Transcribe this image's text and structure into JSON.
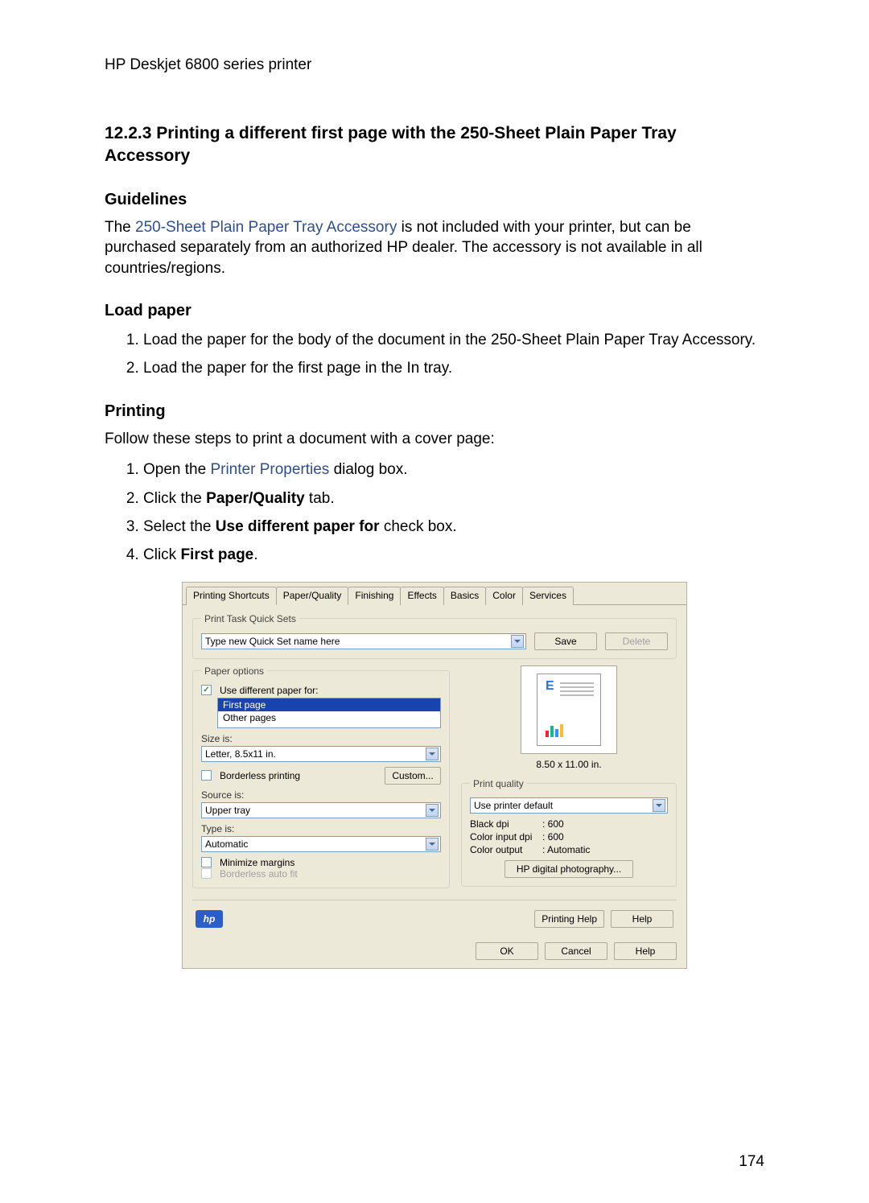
{
  "header": {
    "printer_name": "HP Deskjet 6800 series printer"
  },
  "section": {
    "number_title": "12.2.3  Printing a different first page with the 250-Sheet Plain Paper Tray Accessory"
  },
  "guidelines": {
    "heading": "Guidelines",
    "text_before_link": "The ",
    "link": "250-Sheet Plain Paper Tray Accessory",
    "text_after_link": " is not included with your printer, but can be purchased separately from an authorized HP dealer. The accessory is not available in all countries/regions."
  },
  "loadpaper": {
    "heading": "Load paper",
    "step1": "Load the paper for the body of the document in the 250-Sheet Plain Paper Tray Accessory.",
    "step2": "Load the paper for the first page in the In tray."
  },
  "printing": {
    "heading": "Printing",
    "intro": "Follow these steps to print a document with a cover page:",
    "step1_before": "Open the ",
    "step1_link": "Printer Properties",
    "step1_after": " dialog box.",
    "step2_before": "Click the ",
    "step2_bold": "Paper/Quality",
    "step2_after": " tab.",
    "step3_before": "Select the ",
    "step3_bold": "Use different paper for",
    "step3_after": " check box.",
    "step4_before": "Click ",
    "step4_bold": "First page",
    "step4_after": "."
  },
  "dialog": {
    "tabs": {
      "t1": "Printing Shortcuts",
      "t2": "Paper/Quality",
      "t3": "Finishing",
      "t4": "Effects",
      "t5": "Basics",
      "t6": "Color",
      "t7": "Services"
    },
    "quicksets": {
      "legend": "Print Task Quick Sets",
      "placeholder": "Type new Quick Set name here",
      "save": "Save",
      "delete": "Delete"
    },
    "paper_options": {
      "legend": "Paper options",
      "use_diff": "Use different paper for:",
      "first_page": "First page",
      "other_pages": "Other pages",
      "size_label": "Size is:",
      "size_value": "Letter, 8.5x11 in.",
      "borderless_printing": "Borderless printing",
      "custom_btn": "Custom...",
      "source_label": "Source is:",
      "source_value": "Upper tray",
      "type_label": "Type is:",
      "type_value": "Automatic",
      "minimize_margins": "Minimize margins",
      "borderless_autofit": "Borderless auto fit"
    },
    "preview": {
      "dimensions": "8.50 x 11.00 in."
    },
    "print_quality": {
      "legend": "Print quality",
      "value": "Use printer default",
      "black_dpi_k": "Black dpi",
      "black_dpi_v": ": 600",
      "color_dpi_k": "Color input dpi",
      "color_dpi_v": ": 600",
      "color_out_k": "Color output",
      "color_out_v": ": Automatic",
      "photo_btn": "HP digital photography..."
    },
    "footer": {
      "printing_help": "Printing Help",
      "help": "Help",
      "ok": "OK",
      "cancel": "Cancel"
    },
    "hp": "hp"
  },
  "page_number": "174"
}
